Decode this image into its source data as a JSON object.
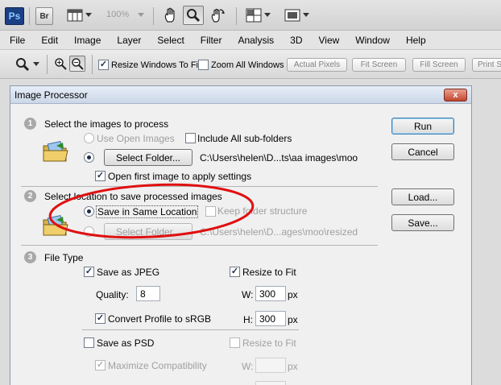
{
  "app": {
    "logo": "Ps",
    "bridge": "Br",
    "zoom": "100%"
  },
  "menu": [
    "File",
    "Edit",
    "Image",
    "Layer",
    "Select",
    "Filter",
    "Analysis",
    "3D",
    "View",
    "Window",
    "Help"
  ],
  "options": {
    "resize_windows": "Resize Windows To Fit",
    "zoom_all_windows": "Zoom All Windows",
    "actual_pixels": "Actual Pixels",
    "fit_screen": "Fit Screen",
    "fill_screen": "Fill Screen",
    "print_size": "Print Si"
  },
  "dialog": {
    "title": "Image Processor",
    "close": "x",
    "buttons": {
      "run": "Run",
      "cancel": "Cancel",
      "load": "Load...",
      "save": "Save..."
    },
    "section1": {
      "number": "1",
      "title": "Select the images to process",
      "use_open_images": "Use Open Images",
      "include_subfolders": "Include All sub-folders",
      "select_folder": "Select Folder...",
      "folder_path": "C:\\Users\\helen\\D...ts\\aa images\\moo",
      "open_first_image": "Open first image to apply settings"
    },
    "section2": {
      "number": "2",
      "title": "Select location to save processed images",
      "save_same_location": "Save in Same Location",
      "keep_folder_structure": "Keep folder structure",
      "select_folder": "Select Folder...",
      "folder_path": "C:\\Users\\helen\\D...ages\\moo\\resized"
    },
    "section3": {
      "number": "3",
      "title": "File Type",
      "save_jpeg": "Save as JPEG",
      "resize_to_fit": "Resize to Fit",
      "quality_label": "Quality:",
      "quality_value": "8",
      "w_label": "W:",
      "w_value": "300",
      "h_label": "H:",
      "h_value": "300",
      "px": "px",
      "convert_srgb": "Convert Profile to sRGB",
      "save_psd": "Save as PSD",
      "resize_to_fit_psd": "Resize to Fit",
      "maximize_compat": "Maximize Compatibility",
      "w_label_psd": "W:",
      "px_psd": "px"
    }
  },
  "colors": {
    "annotation": "#e01010",
    "ps_logo": "#1a3f84"
  }
}
